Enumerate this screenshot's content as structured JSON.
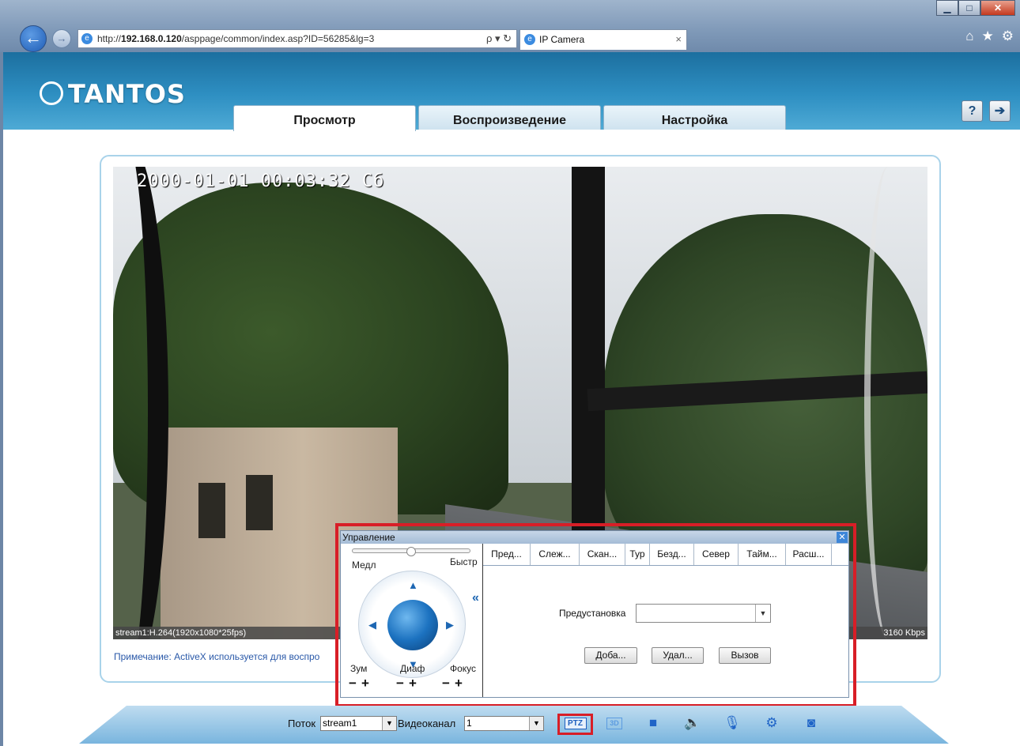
{
  "browser": {
    "url_prefix": "http://",
    "url_host": "192.168.0.120",
    "url_path": "/asppage/common/index.asp?ID=56285&lg=3",
    "search_controls": "ρ ▾ ↻",
    "tab_title": "IP Camera",
    "tab_close": "×",
    "win_min": "▁",
    "win_max": "□",
    "win_close": "✕",
    "tools": [
      "⌂",
      "★",
      "⚙"
    ]
  },
  "header": {
    "logo": "TANTOS",
    "tabs": [
      {
        "label": "Просмотр",
        "active": true
      },
      {
        "label": "Воспроизведение",
        "active": false
      },
      {
        "label": "Настройка",
        "active": false
      }
    ],
    "controls": [
      "help-icon",
      "logout-icon"
    ]
  },
  "video": {
    "osd_timestamp": "2000-01-01 00:03:32 Сб",
    "stream_info": "stream1:H.264(1920x1080*25fps)",
    "bitrate": "3160 Kbps"
  },
  "note": "Примечание: ActiveX используется для воспро",
  "ptz": {
    "title": "Управление",
    "speed_slow": "Медл",
    "speed_fast": "Быстр",
    "speed_level": 0.5,
    "lens": {
      "zoom": "Зум",
      "iris": "Диаф",
      "focus": "Фокус",
      "minus": "−",
      "plus": "+"
    },
    "tabs": [
      "Пред...",
      "Слеж...",
      "Скан...",
      "Тур",
      "Безд...",
      "Север",
      "Тайм...",
      "Расш..."
    ],
    "preset_label": "Предустановка",
    "preset_value": "",
    "buttons": {
      "add": "Доба...",
      "delete": "Удал...",
      "call": "Вызов"
    }
  },
  "toolbar": {
    "stream_label": "Поток",
    "stream_value": "stream1",
    "channel_label": "Видеоканал",
    "channel_value": "1",
    "ptz": "PTZ",
    "three_d": "3D"
  },
  "colors": {
    "header_blue": "#2e8fc2",
    "highlight_red": "#d81e27",
    "accent_blue": "#1f64c7"
  }
}
